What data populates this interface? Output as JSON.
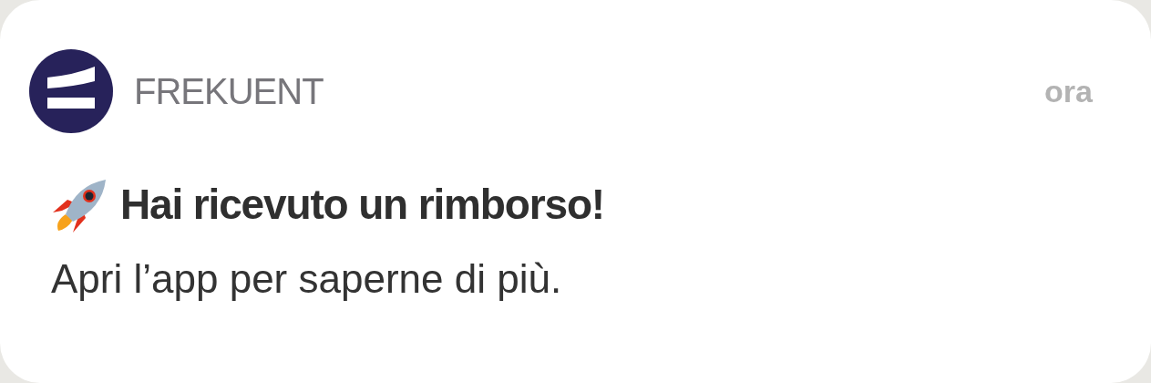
{
  "notification": {
    "app_name": "FREKUENT",
    "time": "ora",
    "title": "Hai ricevuto un rimborso!",
    "body": "Apri l’app per saperne di più."
  }
}
